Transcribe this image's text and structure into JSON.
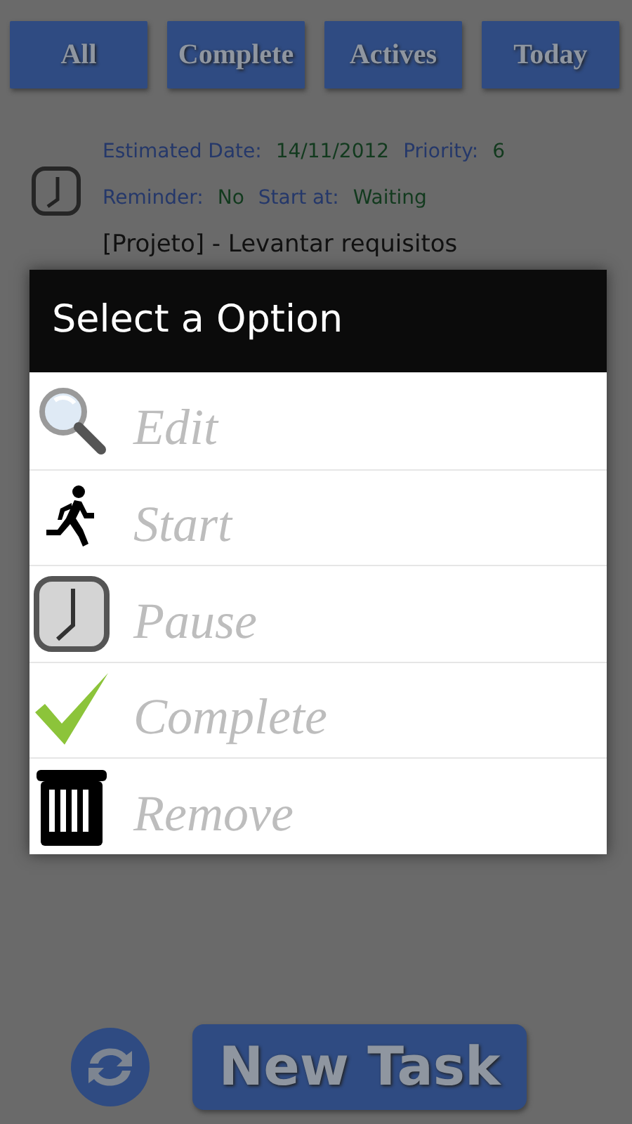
{
  "tabs": [
    {
      "label": "All"
    },
    {
      "label": "Complete"
    },
    {
      "label": "Actives"
    },
    {
      "label": "Today"
    }
  ],
  "task": {
    "lines": [
      [
        {
          "label": "Estimated Date:",
          "value": "14/11/2012"
        },
        {
          "label": "Priority:",
          "value": "6"
        }
      ],
      [
        {
          "label": "Reminder:",
          "value": "No"
        },
        {
          "label": "Start at:",
          "value": "Waiting"
        }
      ]
    ],
    "title": "[Projeto] - Levantar requisitos"
  },
  "dialog": {
    "title": "Select a Option",
    "options": [
      {
        "label": "Edit",
        "kind": "edit"
      },
      {
        "label": "Start",
        "kind": "start"
      },
      {
        "label": "Pause",
        "kind": "pause"
      },
      {
        "label": "Complete",
        "kind": "complete"
      },
      {
        "label": "Remove",
        "kind": "remove"
      }
    ]
  },
  "new_task_button": "New Task"
}
